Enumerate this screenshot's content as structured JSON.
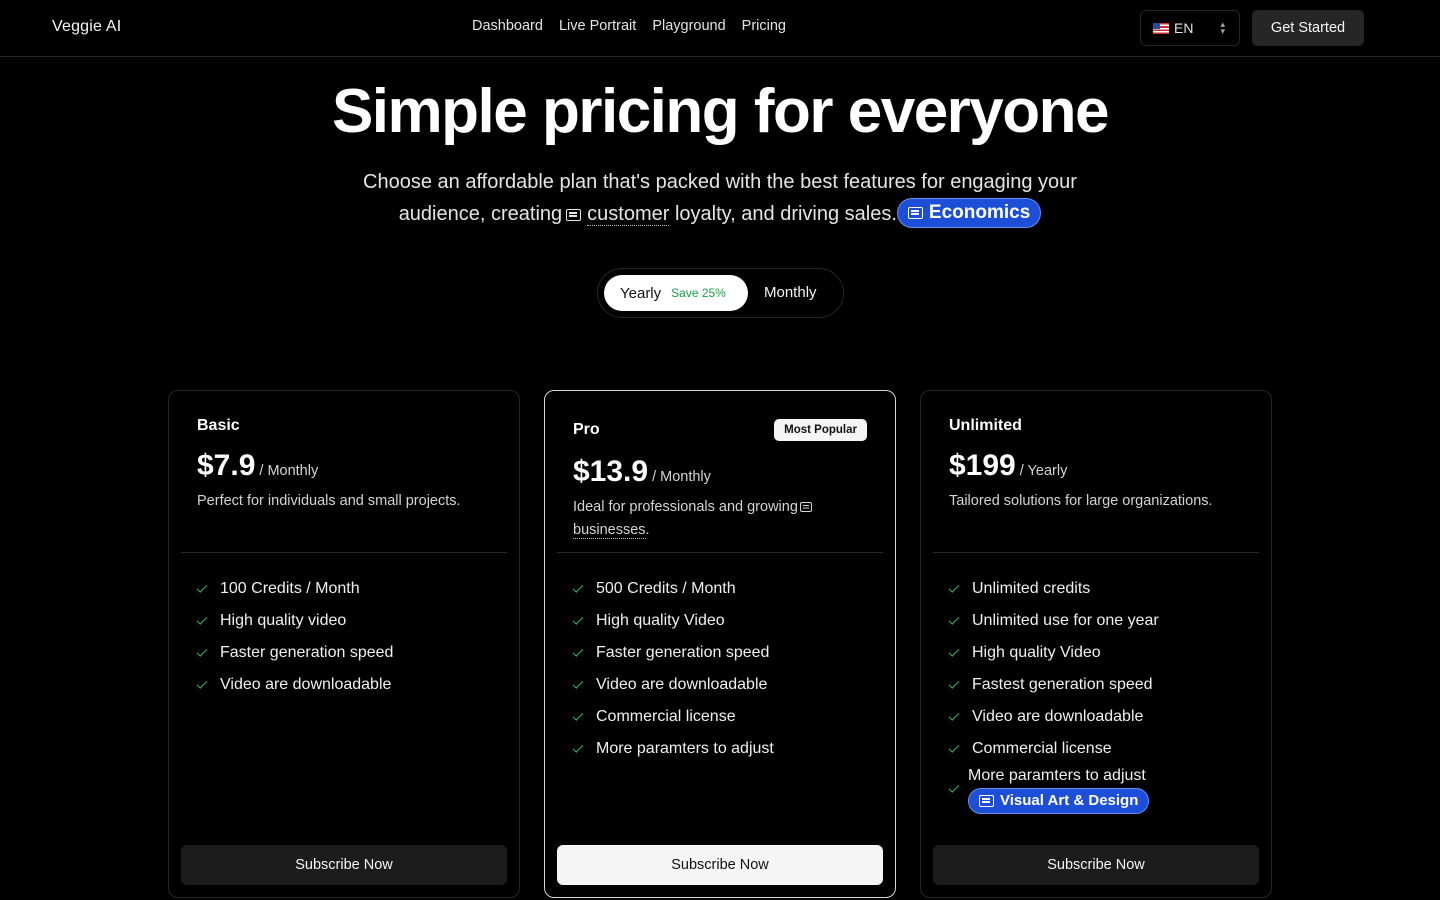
{
  "header": {
    "brand": "Veggie AI",
    "nav": [
      "Dashboard",
      "Live Portrait",
      "Playground",
      "Pricing"
    ],
    "language": "EN",
    "cta": "Get Started"
  },
  "hero": {
    "title": "Simple pricing for everyone",
    "subtitle_part1": "Choose an affordable plan that's packed with the best features for engaging your audience, creating",
    "subtitle_term": "customer",
    "subtitle_part2": "loyalty, and driving sales.",
    "topic_pill": "Economics"
  },
  "billing_toggle": {
    "yearly": "Yearly",
    "save": "Save 25%",
    "monthly": "Monthly",
    "selected": "Yearly"
  },
  "plans": [
    {
      "name": "Basic",
      "price": "$7.9",
      "period": "/ Monthly",
      "description": "Perfect for individuals and small projects.",
      "features": [
        "100 Credits / Month",
        "High quality video",
        "Faster generation speed",
        "Video are downloadable"
      ],
      "button": "Subscribe Now"
    },
    {
      "name": "Pro",
      "badge": "Most Popular",
      "price": "$13.9",
      "period": "/ Monthly",
      "description_part1": "Ideal for professionals and growing",
      "description_term": "businesses",
      "description_end": ".",
      "features": [
        "500 Credits / Month",
        "High quality Video",
        "Faster generation speed",
        "Video are downloadable",
        "Commercial license",
        "More paramters to adjust"
      ],
      "button": "Subscribe Now"
    },
    {
      "name": "Unlimited",
      "price": "$199",
      "period": "/ Yearly",
      "description": "Tailored solutions for large organizations.",
      "features": [
        "Unlimited credits",
        "Unlimited use for one year",
        "High quality Video",
        "Fastest generation speed",
        "Video are downloadable",
        "Commercial license",
        "More paramters to adjust"
      ],
      "feature_pill": "Visual Art & Design",
      "button": "Subscribe Now"
    }
  ],
  "colors": {
    "background": "#000000",
    "check": "#22c55e",
    "save": "#16a34a",
    "pill": "#1d4ed8"
  }
}
